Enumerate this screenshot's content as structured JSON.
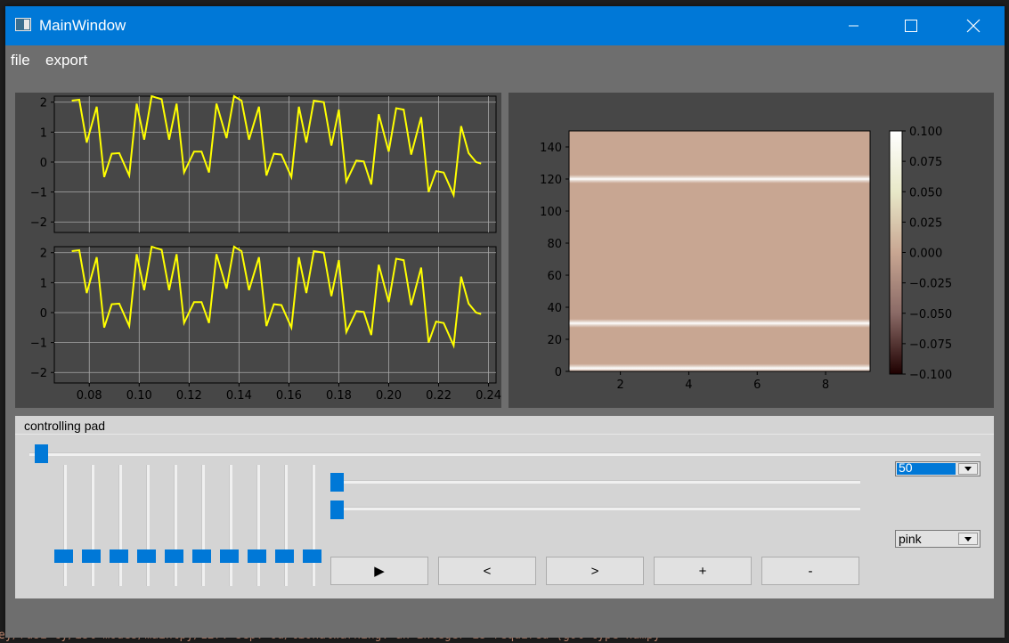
{
  "window": {
    "title": "MainWindow",
    "controls": {
      "minimize_icon": "minimize-icon",
      "maximize_icon": "maximize-icon",
      "close_icon": "close-icon"
    }
  },
  "menu": {
    "items": [
      "file",
      "export"
    ]
  },
  "background_code": {
    "visible_line": "ey/rusi-cy/ist-modes/maintpy/127: sep. ou/tionalwarning: an integer is required (got type numpy"
  },
  "colors": {
    "titlebar": "#0078d7",
    "window_bg": "#6e6e6e",
    "plot_panel_bg": "#474747",
    "signal_line": "#ffff00",
    "slider_handle": "#0078d7",
    "spectrogram_base": "#c8a692",
    "spectrogram_peak": "#ffffff"
  },
  "plots": {
    "upper": {
      "y_ticks": [
        "2",
        "1",
        "0",
        "−1",
        "−2"
      ]
    },
    "lower": {
      "y_ticks": [
        "2",
        "1",
        "0",
        "−1",
        "−2"
      ],
      "x_ticks": [
        "0.08",
        "0.10",
        "0.12",
        "0.14",
        "0.16",
        "0.18",
        "0.20",
        "0.22",
        "0.24"
      ]
    },
    "spectrogram": {
      "y_ticks": [
        "140",
        "120",
        "100",
        "80",
        "60",
        "40",
        "20",
        "0"
      ],
      "x_ticks": [
        "2",
        "4",
        "6",
        "8"
      ],
      "colorbar_ticks": [
        "0.100",
        "0.075",
        "0.050",
        "0.025",
        "0.000",
        "−0.025",
        "−0.050",
        "−0.075",
        "−0.100"
      ]
    }
  },
  "chart_data": [
    {
      "type": "line",
      "title": "",
      "xlabel": "",
      "ylabel": "",
      "xlim": [
        0.066,
        0.243
      ],
      "ylim": [
        -2.35,
        2.2
      ],
      "grid": true,
      "series": [
        {
          "x": [
            0.073,
            0.076,
            0.079,
            0.083,
            0.086,
            0.089,
            0.092,
            0.096,
            0.099,
            0.102,
            0.105,
            0.109,
            0.112,
            0.115,
            0.118,
            0.122,
            0.125,
            0.128,
            0.131,
            0.135,
            0.138,
            0.141,
            0.144,
            0.148,
            0.151,
            0.154,
            0.157,
            0.161,
            0.164,
            0.167,
            0.17,
            0.174,
            0.177,
            0.18,
            0.183,
            0.187,
            0.19,
            0.193,
            0.196,
            0.2,
            0.203,
            0.206,
            0.209,
            0.213,
            0.216,
            0.219,
            0.222,
            0.226,
            0.229,
            0.232,
            0.235,
            0.237
          ],
          "y": [
            2.05,
            2.08,
            0.65,
            1.85,
            -0.5,
            0.28,
            0.3,
            -0.45,
            1.95,
            0.75,
            2.25,
            2.1,
            0.75,
            1.95,
            -0.35,
            0.35,
            0.35,
            -0.35,
            1.95,
            0.8,
            2.25,
            2.05,
            0.75,
            1.85,
            -0.45,
            0.28,
            0.25,
            -0.5,
            1.85,
            0.65,
            2.05,
            2.0,
            0.55,
            1.75,
            -0.65,
            0.05,
            0.02,
            -0.75,
            1.6,
            0.35,
            1.8,
            1.75,
            0.25,
            1.5,
            -1.0,
            -0.3,
            -0.35,
            -1.1,
            1.2,
            0.3,
            0.0,
            -0.05
          ]
        }
      ]
    },
    {
      "type": "line",
      "title": "",
      "xlabel": "",
      "ylabel": "",
      "xlim": [
        0.066,
        0.243
      ],
      "ylim": [
        -2.35,
        2.2
      ],
      "grid": true,
      "series": [
        {
          "x": [
            0.073,
            0.076,
            0.079,
            0.083,
            0.086,
            0.089,
            0.092,
            0.096,
            0.099,
            0.102,
            0.105,
            0.109,
            0.112,
            0.115,
            0.118,
            0.122,
            0.125,
            0.128,
            0.131,
            0.135,
            0.138,
            0.141,
            0.144,
            0.148,
            0.151,
            0.154,
            0.157,
            0.161,
            0.164,
            0.167,
            0.17,
            0.174,
            0.177,
            0.18,
            0.183,
            0.187,
            0.19,
            0.193,
            0.196,
            0.2,
            0.203,
            0.206,
            0.209,
            0.213,
            0.216,
            0.219,
            0.222,
            0.226,
            0.229,
            0.232,
            0.235,
            0.237
          ],
          "y": [
            2.05,
            2.08,
            0.65,
            1.85,
            -0.5,
            0.28,
            0.3,
            -0.45,
            1.95,
            0.75,
            2.25,
            2.1,
            0.75,
            1.95,
            -0.35,
            0.35,
            0.35,
            -0.35,
            1.95,
            0.8,
            2.25,
            2.05,
            0.75,
            1.85,
            -0.45,
            0.28,
            0.25,
            -0.5,
            1.85,
            0.65,
            2.05,
            2.0,
            0.55,
            1.75,
            -0.65,
            0.05,
            0.02,
            -0.75,
            1.6,
            0.35,
            1.8,
            1.75,
            0.25,
            1.5,
            -1.0,
            -0.3,
            -0.35,
            -1.1,
            1.2,
            0.3,
            0.0,
            -0.05
          ]
        }
      ]
    },
    {
      "type": "heatmap",
      "title": "",
      "xlim": [
        0.5,
        9.3
      ],
      "ylim": [
        0,
        150
      ],
      "bright_rows_y": [
        2,
        30,
        120
      ],
      "colorbar_range": [
        -0.1,
        0.1
      ],
      "colormap": "pink"
    }
  ],
  "controlling_pad": {
    "title": "controlling pad",
    "top_slider_value": 0,
    "vertical_slider_values": [
      0,
      0,
      0,
      0,
      0,
      0,
      0,
      0,
      0,
      0
    ],
    "horizontal_slider_values": [
      0,
      0
    ],
    "buttons": [
      "▶",
      "<",
      ">",
      "+",
      "-"
    ],
    "speed_combo": {
      "value": "50"
    },
    "colormap_combo": {
      "value": "pink"
    }
  }
}
